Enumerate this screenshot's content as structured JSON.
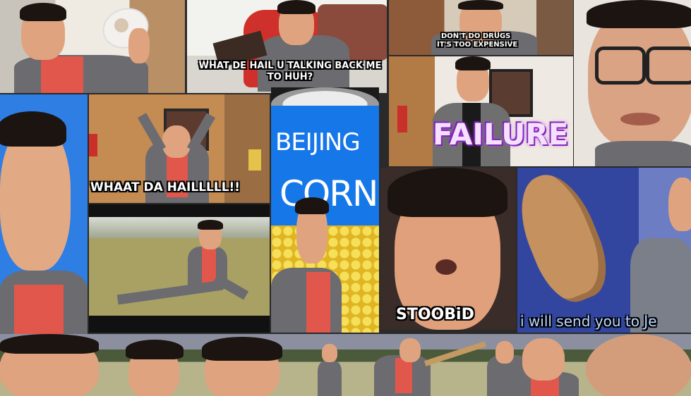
{
  "captions": {
    "talking_back": "WHAT DE HAIL U TALKING BACK ME TO HUH?",
    "dont_do_drugs_line1": "DON'T DO DRUGS",
    "dont_do_drugs_line2": "IT'S TOO EXPENSIVE",
    "failure": "FAILURE",
    "whaat": "WHAAT DA HAILLLLL!!",
    "can_beijing": "BEIJING",
    "can_corn": "CORN",
    "stoobid": "STOOBiD",
    "send_to": "i will send you to Je"
  }
}
